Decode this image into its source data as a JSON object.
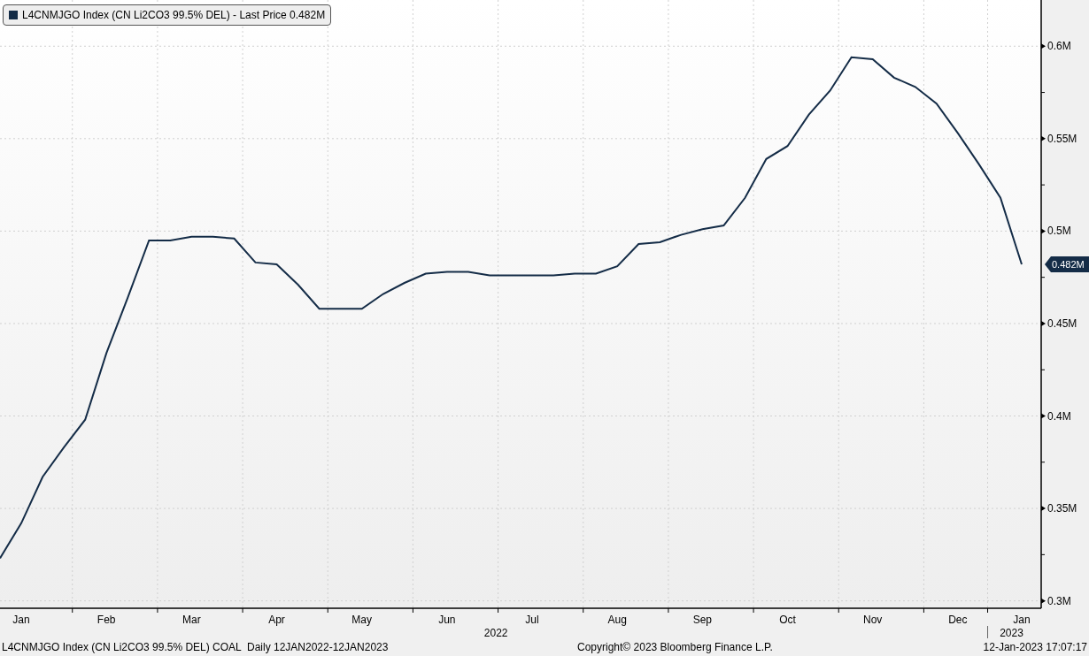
{
  "legend": {
    "text": "L4CNMJGO Index (CN Li2CO3 99.5% DEL) - Last Price 0.482M"
  },
  "chart": {
    "last_value_label": "0.482M",
    "chart_data": {
      "type": "line",
      "ylim": [
        0.296,
        0.625
      ],
      "categories": [
        null,
        "Jan",
        null,
        null,
        null,
        "Feb",
        null,
        null,
        null,
        "Mar",
        null,
        null,
        null,
        "Apr",
        null,
        null,
        null,
        "May",
        null,
        null,
        null,
        "Jun",
        null,
        null,
        null,
        "Jul",
        null,
        null,
        null,
        "Aug",
        null,
        null,
        null,
        "Sep",
        null,
        null,
        null,
        "Oct",
        null,
        null,
        null,
        "Nov",
        null,
        null,
        null,
        "Dec",
        null,
        null,
        "Jan"
      ],
      "yticks": [
        {
          "value": 0.3,
          "label": "0.3M"
        },
        {
          "value": 0.35,
          "label": "0.35M"
        },
        {
          "value": 0.4,
          "label": "0.4M"
        },
        {
          "value": 0.45,
          "label": "0.45M"
        },
        {
          "value": 0.5,
          "label": "0.5M"
        },
        {
          "value": 0.55,
          "label": "0.55M"
        },
        {
          "value": 0.6,
          "label": "0.6M"
        }
      ],
      "annotations": [
        "2022",
        "2023"
      ],
      "grid": true,
      "series": [
        {
          "color": "#142c47",
          "values": [
            0.323,
            0.342,
            0.367,
            0.383,
            0.398,
            0.434,
            0.464,
            0.495,
            0.495,
            0.497,
            0.497,
            0.496,
            0.483,
            0.482,
            0.471,
            0.458,
            0.458,
            0.458,
            0.466,
            0.472,
            0.477,
            0.478,
            0.478,
            0.476,
            0.476,
            0.476,
            0.476,
            0.477,
            0.477,
            0.481,
            0.493,
            0.494,
            0.498,
            0.501,
            0.503,
            0.518,
            0.539,
            0.546,
            0.563,
            0.576,
            0.594,
            0.593,
            0.583,
            0.578,
            0.569,
            0.553,
            0.536,
            0.518,
            0.482
          ]
        }
      ]
    }
  },
  "footer": {
    "description": "L4CNMJGO Index (CN Li2CO3 99.5% DEL) COAL  Daily 12JAN2022-12JAN2023",
    "copyright": "Copyright© 2023 Bloomberg Finance L.P.",
    "timestamp": "12-Jan-2023 17:07:17"
  }
}
